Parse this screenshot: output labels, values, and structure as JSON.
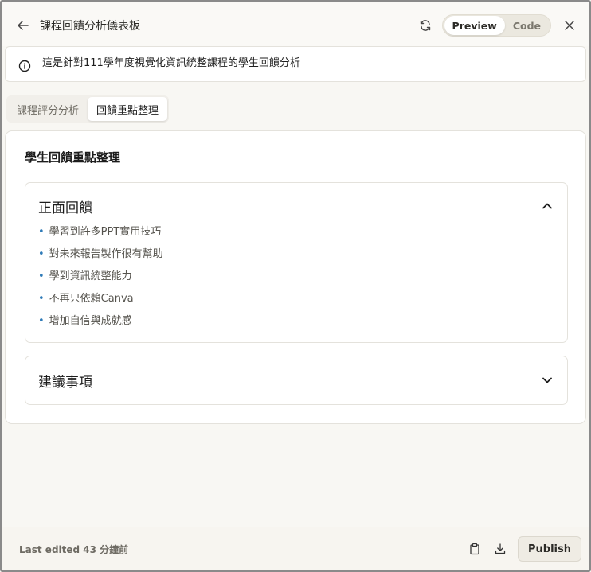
{
  "header": {
    "title": "課程回饋分析儀表板",
    "toggle": {
      "preview_label": "Preview",
      "code_label": "Code",
      "selected": "Preview"
    }
  },
  "alert": {
    "text": "這是針對111學年度視覺化資訊統整課程的學生回饋分析"
  },
  "tabs": [
    {
      "label": "課程評分分析",
      "active": false
    },
    {
      "label": "回饋重點整理",
      "active": true
    }
  ],
  "card": {
    "title": "學生回饋重點整理",
    "sections": [
      {
        "title": "正面回饋",
        "expanded": true,
        "items": [
          "學習到許多PPT實用技巧",
          "對未來報告製作很有幫助",
          "學到資訊統整能力",
          "不再只依賴Canva",
          "增加自信與成就感"
        ]
      },
      {
        "title": "建議事項",
        "expanded": false,
        "items": []
      }
    ]
  },
  "footer": {
    "last_edited": "Last edited 43 分鐘前",
    "publish_label": "Publish"
  },
  "colors": {
    "accent_bullet": "#2f7bb8",
    "background": "#f7f5f0"
  }
}
